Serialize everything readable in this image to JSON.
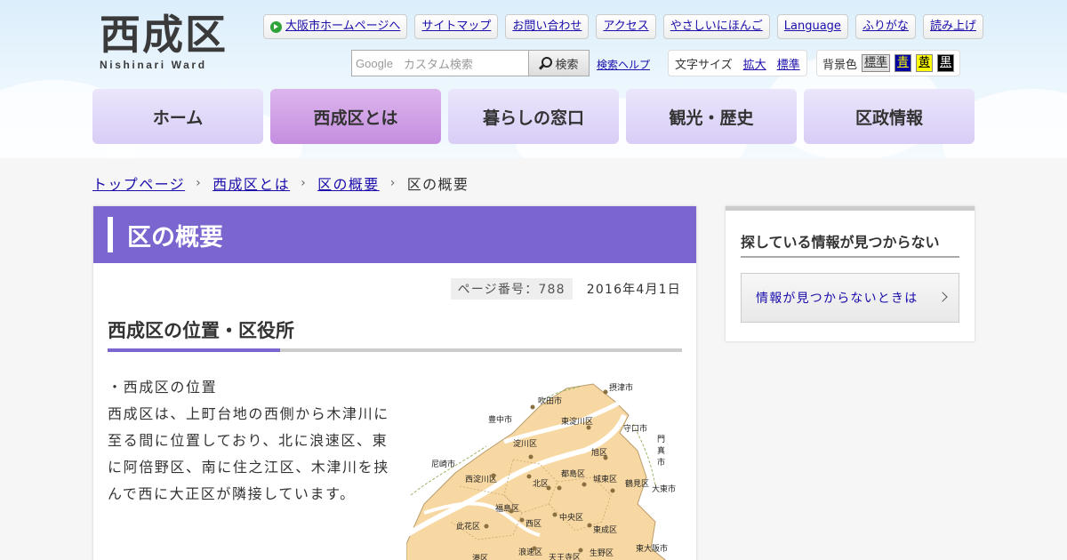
{
  "header": {
    "logo_kanji": "西成区",
    "logo_en": "Nishinari Ward",
    "top_links": [
      "大阪市ホームページへ",
      "サイトマップ",
      "お問い合わせ",
      "アクセス",
      "やさしいにほんご",
      "Language",
      "ふりがな",
      "読み上げ"
    ],
    "search": {
      "google_label": "Google",
      "placeholder": "カスタム検索",
      "button": "検索",
      "help": "検索ヘルプ"
    },
    "font_size": {
      "label": "文字サイズ",
      "larger": "拡大",
      "normal": "標準"
    },
    "bg_color": {
      "label": "背景色",
      "options": [
        {
          "label": "標準",
          "bg": "#e0e0e0",
          "fg": "#333333"
        },
        {
          "label": "青",
          "bg": "#0000a0",
          "fg": "#ffff00"
        },
        {
          "label": "黄",
          "bg": "#ffff00",
          "fg": "#000000"
        },
        {
          "label": "黒",
          "bg": "#000000",
          "fg": "#ffffff"
        }
      ]
    }
  },
  "nav": [
    "ホーム",
    "西成区とは",
    "暮らしの窓口",
    "観光・歴史",
    "区政情報"
  ],
  "breadcrumb": [
    "トップページ",
    "西成区とは",
    "区の概要",
    "区の概要"
  ],
  "main": {
    "title": "区の概要",
    "page_number": "ページ番号：788",
    "date": "2016年4月1日",
    "heading": "西成区の位置・区役所",
    "paragraph_lines": [
      "・西成区の位置",
      "西成区は、上町台地の西側から木津川に",
      "至る間に位置しており、北に浪速区、東",
      "に阿倍野区、南に住之江区、木津川を挟",
      "んで西に大正区が隣接しています。"
    ]
  },
  "map_labels": [
    "摂津市",
    "吹田市",
    "豊中市",
    "東淀川区",
    "守口市",
    "門",
    "真",
    "市",
    "淀川区",
    "旭区",
    "尼崎市",
    "西淀川区",
    "北区",
    "都島区",
    "城東区",
    "鶴見区",
    "大東市",
    "福島区",
    "中央区",
    "此花区",
    "西区",
    "東成区",
    "浪速区",
    "天王寺区",
    "生野区",
    "東大阪市",
    "港区"
  ],
  "sidebar": {
    "title": "探している情報が見つからない",
    "button": "情報が見つからないときは"
  },
  "colors": {
    "accent": "#7b66d0",
    "nav_active": "#c58ee0",
    "link": "#1a0dab",
    "map_fill": "#f8d8a2"
  }
}
